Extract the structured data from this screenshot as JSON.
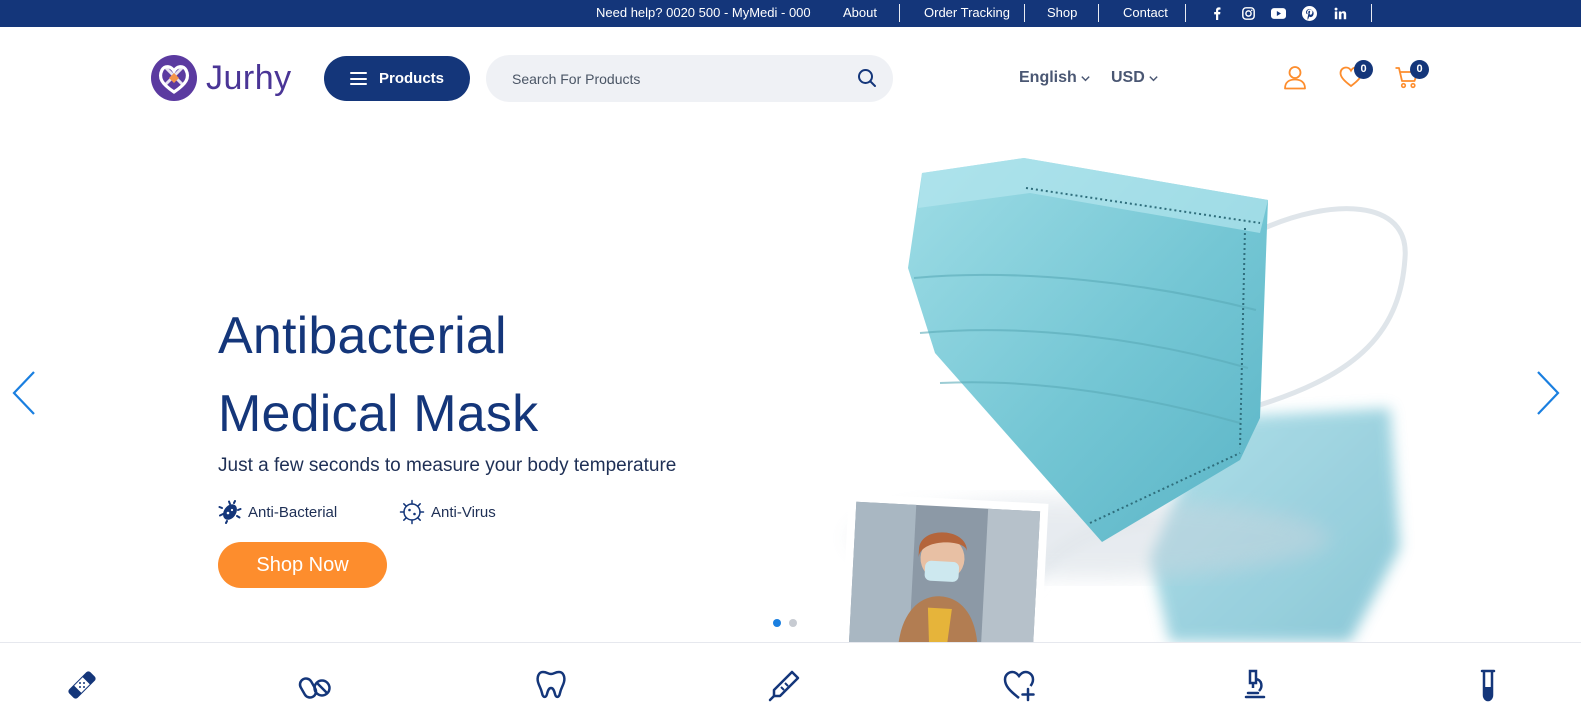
{
  "topbar": {
    "help": "Need help? 0020 500 - MyMedi - 000",
    "links": [
      "About",
      "Order Tracking",
      "Shop",
      "Contact"
    ],
    "social_icons": [
      "facebook-icon",
      "instagram-icon",
      "youtube-icon",
      "pinterest-icon",
      "linkedin-icon"
    ]
  },
  "header": {
    "brand": "Jurhy",
    "products_label": "Products",
    "search_placeholder": "Search For Products",
    "language": "English",
    "currency": "USD",
    "wishlist_count": "0",
    "cart_count": "0"
  },
  "hero": {
    "title_line1": "Antibacterial",
    "title_line2": "Medical Mask",
    "subtitle": "Just a few seconds to measure your body temperature",
    "features": [
      "Anti-Bacterial",
      "Anti-Virus"
    ],
    "cta": "Shop Now",
    "slide_count": 2,
    "active_slide": 1
  },
  "categories": [
    "bandage-icon",
    "pills-icon",
    "tooth-icon",
    "syringe-icon",
    "heart-plus-icon",
    "microscope-icon",
    "test-tube-icon"
  ],
  "colors": {
    "navy": "#14367a",
    "orange": "#fd8d2d",
    "accent_blue": "#1a7fe0",
    "brand_purple": "#4a3596",
    "mask_teal": "#7fcfdc"
  }
}
